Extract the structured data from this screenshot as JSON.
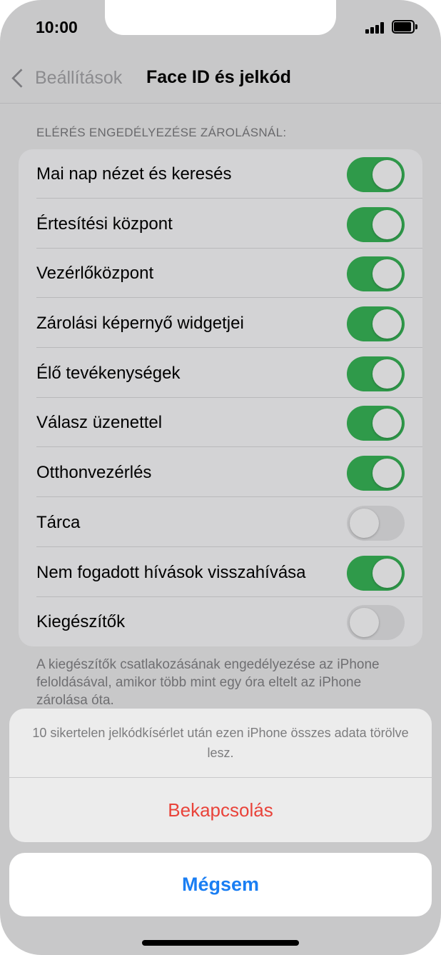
{
  "status_bar": {
    "time": "10:00",
    "signal_icon": "cellular-signal-icon",
    "battery_icon": "battery-full-icon"
  },
  "nav": {
    "back_label": "Beállítások",
    "back_icon": "chevron-left-icon",
    "title": "Face ID és jelkód"
  },
  "section": {
    "header": "ELÉRÉS ENGEDÉLYEZÉSE ZÁROLÁSNÁL:",
    "items": [
      {
        "label": "Mai nap nézet és keresés",
        "on": true
      },
      {
        "label": "Értesítési központ",
        "on": true
      },
      {
        "label": "Vezérlőközpont",
        "on": true
      },
      {
        "label": "Zárolási képernyő widgetjei",
        "on": true
      },
      {
        "label": "Élő tevékenységek",
        "on": true
      },
      {
        "label": "Válasz üzenettel",
        "on": true
      },
      {
        "label": "Otthonvezérlés",
        "on": true
      },
      {
        "label": "Tárca",
        "on": false
      },
      {
        "label": "Nem fogadott hívások visszahívása",
        "on": true
      },
      {
        "label": "Kiegészítők",
        "on": false
      }
    ],
    "footer": "A kiegészítők csatlakozásának engedélyezése az iPhone feloldásával, amikor több mint egy óra eltelt az iPhone zárolása óta."
  },
  "action_sheet": {
    "message": "10 sikertelen jelkódkísérlet után ezen iPhone összes adata törölve lesz.",
    "confirm_label": "Bekapcsolás",
    "cancel_label": "Mégsem"
  },
  "colors": {
    "toggle_on": "#2f9a4a",
    "destructive": "#e9433a",
    "link": "#1a7ef3"
  }
}
